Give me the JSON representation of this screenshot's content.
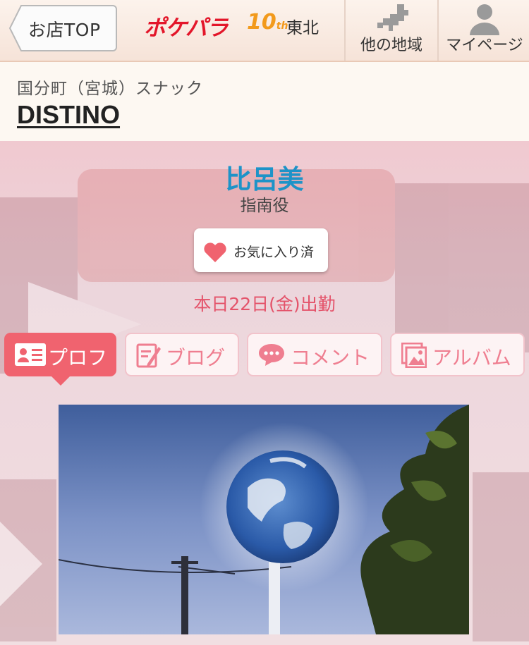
{
  "header": {
    "back_label": "お店TOP",
    "logo_brand": "ポケパラ",
    "logo_anniversary": "10",
    "logo_anniversary_suffix": "th",
    "logo_region": "東北",
    "other_region_label": "他の地域",
    "mypage_label": "マイページ"
  },
  "shop": {
    "meta": "国分町（宮城）スナック",
    "name": "DISTINO"
  },
  "cast": {
    "name": "比呂美",
    "role": "指南役",
    "favorite_label": "お気に入り済",
    "schedule": "本日22日(金)出勤"
  },
  "tabs": [
    {
      "label": "プロフ",
      "icon": "profile-card-icon",
      "active": true
    },
    {
      "label": "ブログ",
      "icon": "blog-edit-icon",
      "active": false
    },
    {
      "label": "コメント",
      "icon": "comment-bubble-icon",
      "active": false
    },
    {
      "label": "アルバム",
      "icon": "album-photo-icon",
      "active": false
    }
  ],
  "colors": {
    "accent": "#f0636f",
    "cast_name": "#1d93c8",
    "schedule": "#e4536a",
    "logo_red": "#e3162a"
  }
}
